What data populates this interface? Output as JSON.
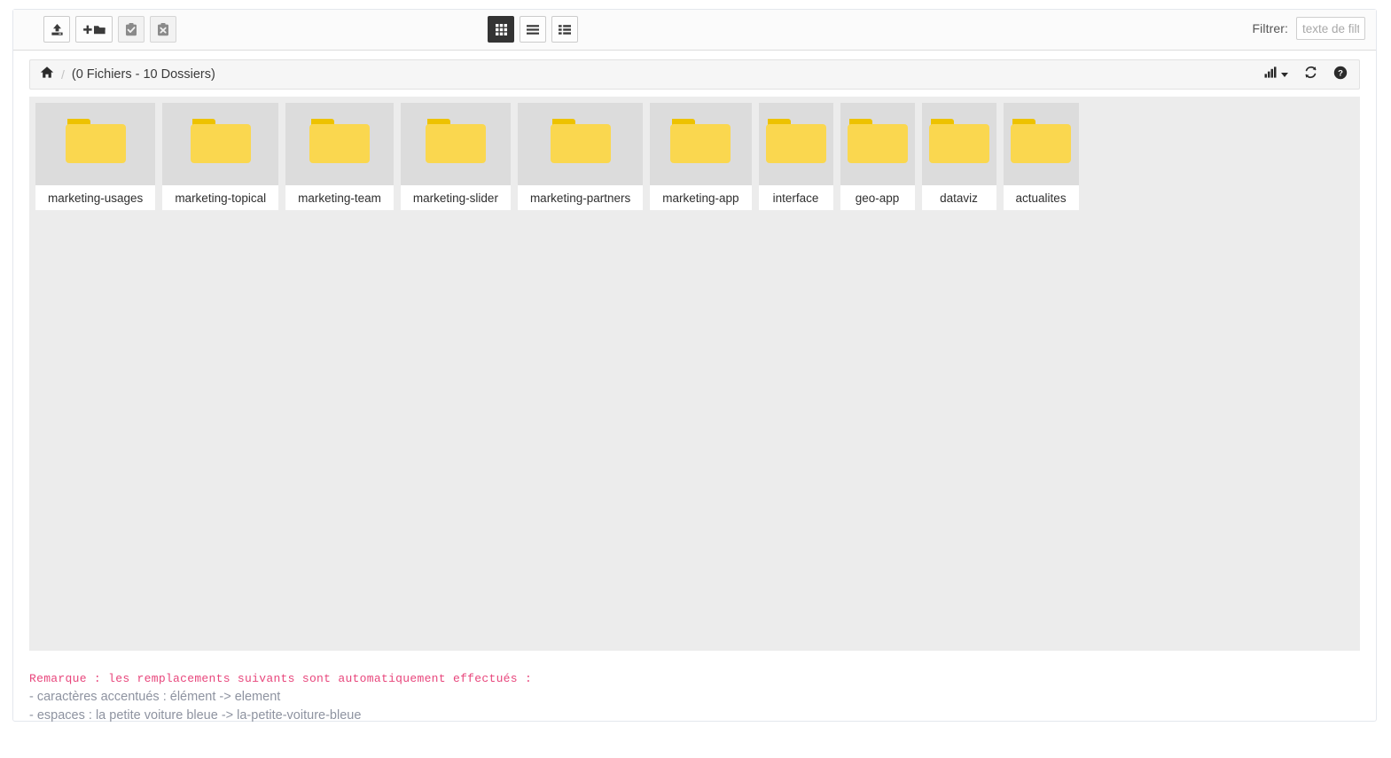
{
  "toolbar": {
    "actions": [
      {
        "name": "upload-button",
        "icon": "upload-icon",
        "label": "Envoyer",
        "disabled": false,
        "wide": false
      },
      {
        "name": "new-folder-button",
        "icon": "add-folder-icon",
        "label": "Nouveau dossier",
        "disabled": false,
        "wide": true
      },
      {
        "name": "paste-button",
        "icon": "clipboard-check-icon",
        "label": "Coller",
        "disabled": true,
        "wide": false
      },
      {
        "name": "clear-clipboard-button",
        "icon": "clipboard-x-icon",
        "label": "Vider le presse-papiers",
        "disabled": true,
        "wide": false
      }
    ],
    "views": [
      {
        "name": "view-grid-button",
        "icon": "grid-view-icon",
        "label": "Vignettes",
        "active": true
      },
      {
        "name": "view-list-button",
        "icon": "list-view-icon",
        "label": "Liste",
        "active": false
      },
      {
        "name": "view-details-button",
        "icon": "details-view-icon",
        "label": "Détails",
        "active": false
      }
    ],
    "filter_label": "Filtrer:",
    "filter_value": "",
    "filter_placeholder": "texte de filtrage"
  },
  "breadcrumb": {
    "home_icon": "home-icon",
    "separator": "/",
    "summary": "(0 Fichiers - 10 Dossiers)",
    "actions": [
      {
        "name": "storage-usage-button",
        "icon": "bar-chart-icon",
        "label": "Espace utilisé"
      },
      {
        "name": "refresh-button",
        "icon": "refresh-icon",
        "label": "Rafraîchir"
      },
      {
        "name": "help-button",
        "icon": "help-icon",
        "label": "Aide"
      }
    ]
  },
  "content": {
    "items": [
      {
        "name": "marketing-usages",
        "type": "folder",
        "icon": "folder-icon"
      },
      {
        "name": "marketing-topical",
        "type": "folder",
        "icon": "folder-icon"
      },
      {
        "name": "marketing-team",
        "type": "folder",
        "icon": "folder-icon"
      },
      {
        "name": "marketing-slider",
        "type": "folder",
        "icon": "folder-icon"
      },
      {
        "name": "marketing-partners",
        "type": "folder",
        "icon": "folder-icon"
      },
      {
        "name": "marketing-app",
        "type": "folder",
        "icon": "folder-icon"
      },
      {
        "name": "interface",
        "type": "folder",
        "icon": "folder-icon"
      },
      {
        "name": "geo-app",
        "type": "folder",
        "icon": "folder-icon"
      },
      {
        "name": "dataviz",
        "type": "folder",
        "icon": "folder-icon"
      },
      {
        "name": "actualites",
        "type": "folder",
        "icon": "folder-icon"
      }
    ]
  },
  "note": {
    "heading": "Remarque : les remplacements suivants sont automatiquement effectués :",
    "lines": [
      "- caractères accentués : élément -> element",
      "- espaces : la petite voiture bleue -> la-petite-voiture-bleue"
    ]
  },
  "colors": {
    "accent_pink": "#e8467c",
    "folder_body": "#fad74f",
    "folder_tab": "#edc200",
    "thumb_bg": "#dcdcdc",
    "content_bg": "#ececec",
    "active_button": "#333333"
  }
}
